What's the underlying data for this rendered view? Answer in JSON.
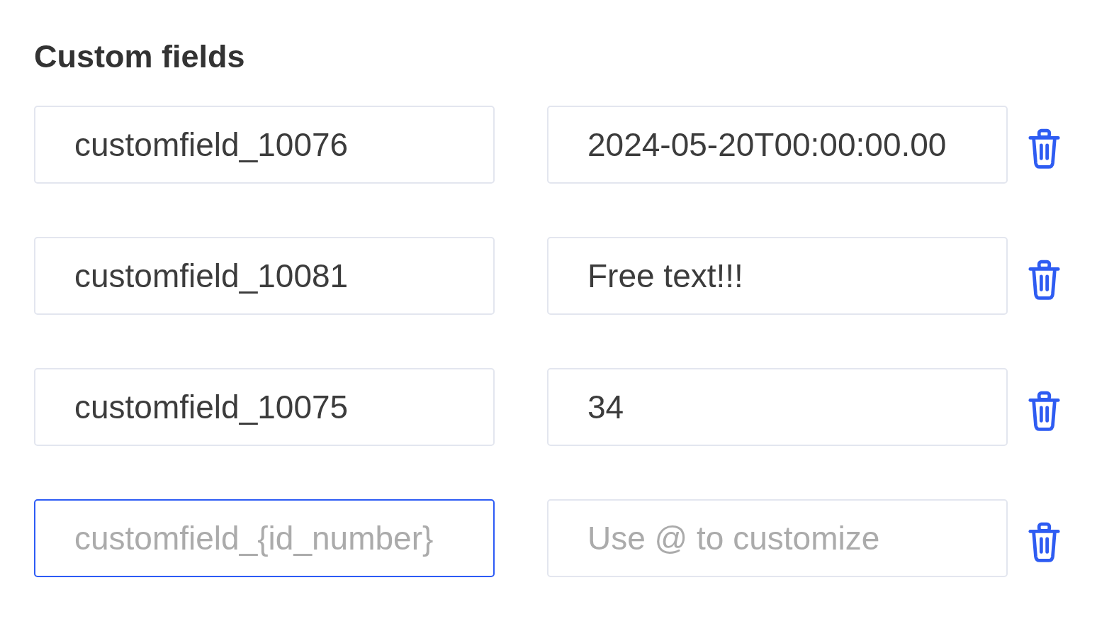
{
  "heading": "Custom fields",
  "rows": [
    {
      "key_field": {
        "value": "customfield_10076",
        "focused": false
      },
      "value_field": {
        "value": "2024-05-20T00:00:00.00",
        "focused": false
      }
    },
    {
      "key_field": {
        "value": "customfield_10081",
        "focused": false
      },
      "value_field": {
        "value": "Free text!!!",
        "focused": false
      }
    },
    {
      "key_field": {
        "value": "customfield_10075",
        "focused": false
      },
      "value_field": {
        "value": "34",
        "focused": false
      }
    },
    {
      "key_field": {
        "placeholder": "customfield_{id_number}",
        "focused": true
      },
      "value_field": {
        "placeholder": "Use @ to customize",
        "focused": false
      }
    }
  ]
}
